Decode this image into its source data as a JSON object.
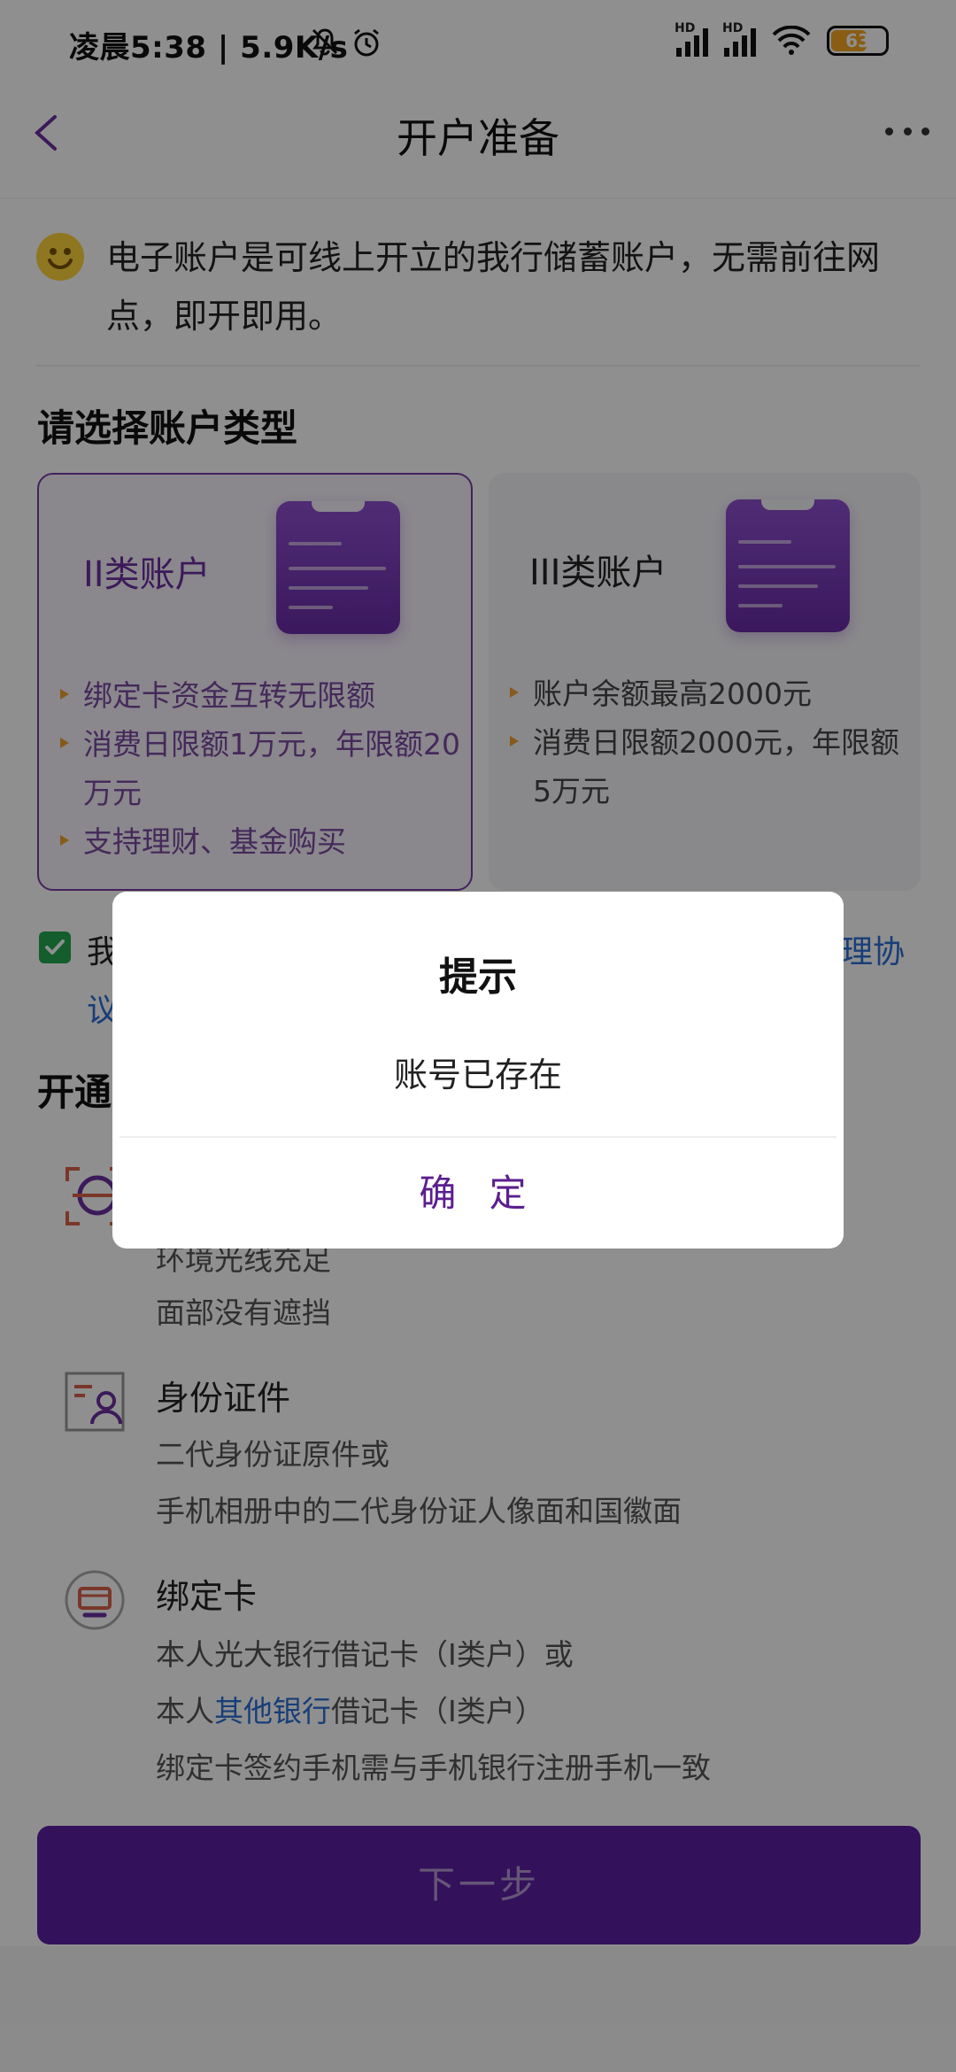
{
  "status_bar": {
    "time_network": "凌晨5:38 | 5.9K/s",
    "hd_label": "HD",
    "battery": "63"
  },
  "nav": {
    "title": "开户准备"
  },
  "intro": {
    "text": "电子账户是可线上开立的我行储蓄账户，无需前往网点，即开即用。"
  },
  "account_type": {
    "title": "请选择账户类型",
    "cards": [
      {
        "title": "II类账户",
        "bullets": [
          "绑定卡资金互转无限额",
          "消费日限额1万元，年限额20万元",
          "支持理财、基金购买"
        ]
      },
      {
        "title": "III类账户",
        "bullets": [
          "账户余额最高2000元",
          "消费日限额2000元，年限额5万元"
        ]
      }
    ]
  },
  "agreement": {
    "prefix": "我",
    "link_tail": "理协",
    "line2": "议"
  },
  "requirements": {
    "title_partial": "开通",
    "items": [
      {
        "title": "",
        "lines": [
          "环境光线充足",
          "面部没有遮挡"
        ]
      },
      {
        "title": "身份证件",
        "lines": [
          "二代身份证原件或",
          "手机相册中的二代身份证人像面和国徽面"
        ]
      },
      {
        "title": "绑定卡",
        "line1": "本人光大银行借记卡（Ⅰ类户）或",
        "line2_pre": "本人",
        "line2_link": "其他银行",
        "line2_post": "借记卡（Ⅰ类户）",
        "line3": "绑定卡签约手机需与手机银行注册手机一致"
      }
    ]
  },
  "next_button": {
    "label": "下一步"
  },
  "dialog": {
    "title": "提示",
    "message": "账号已存在",
    "confirm": "确 定"
  },
  "colors": {
    "brand_purple": "#5b1fa3",
    "link_blue": "#2b6fd6",
    "check_green": "#22a84f",
    "bullet_orange": "#f0a030"
  }
}
